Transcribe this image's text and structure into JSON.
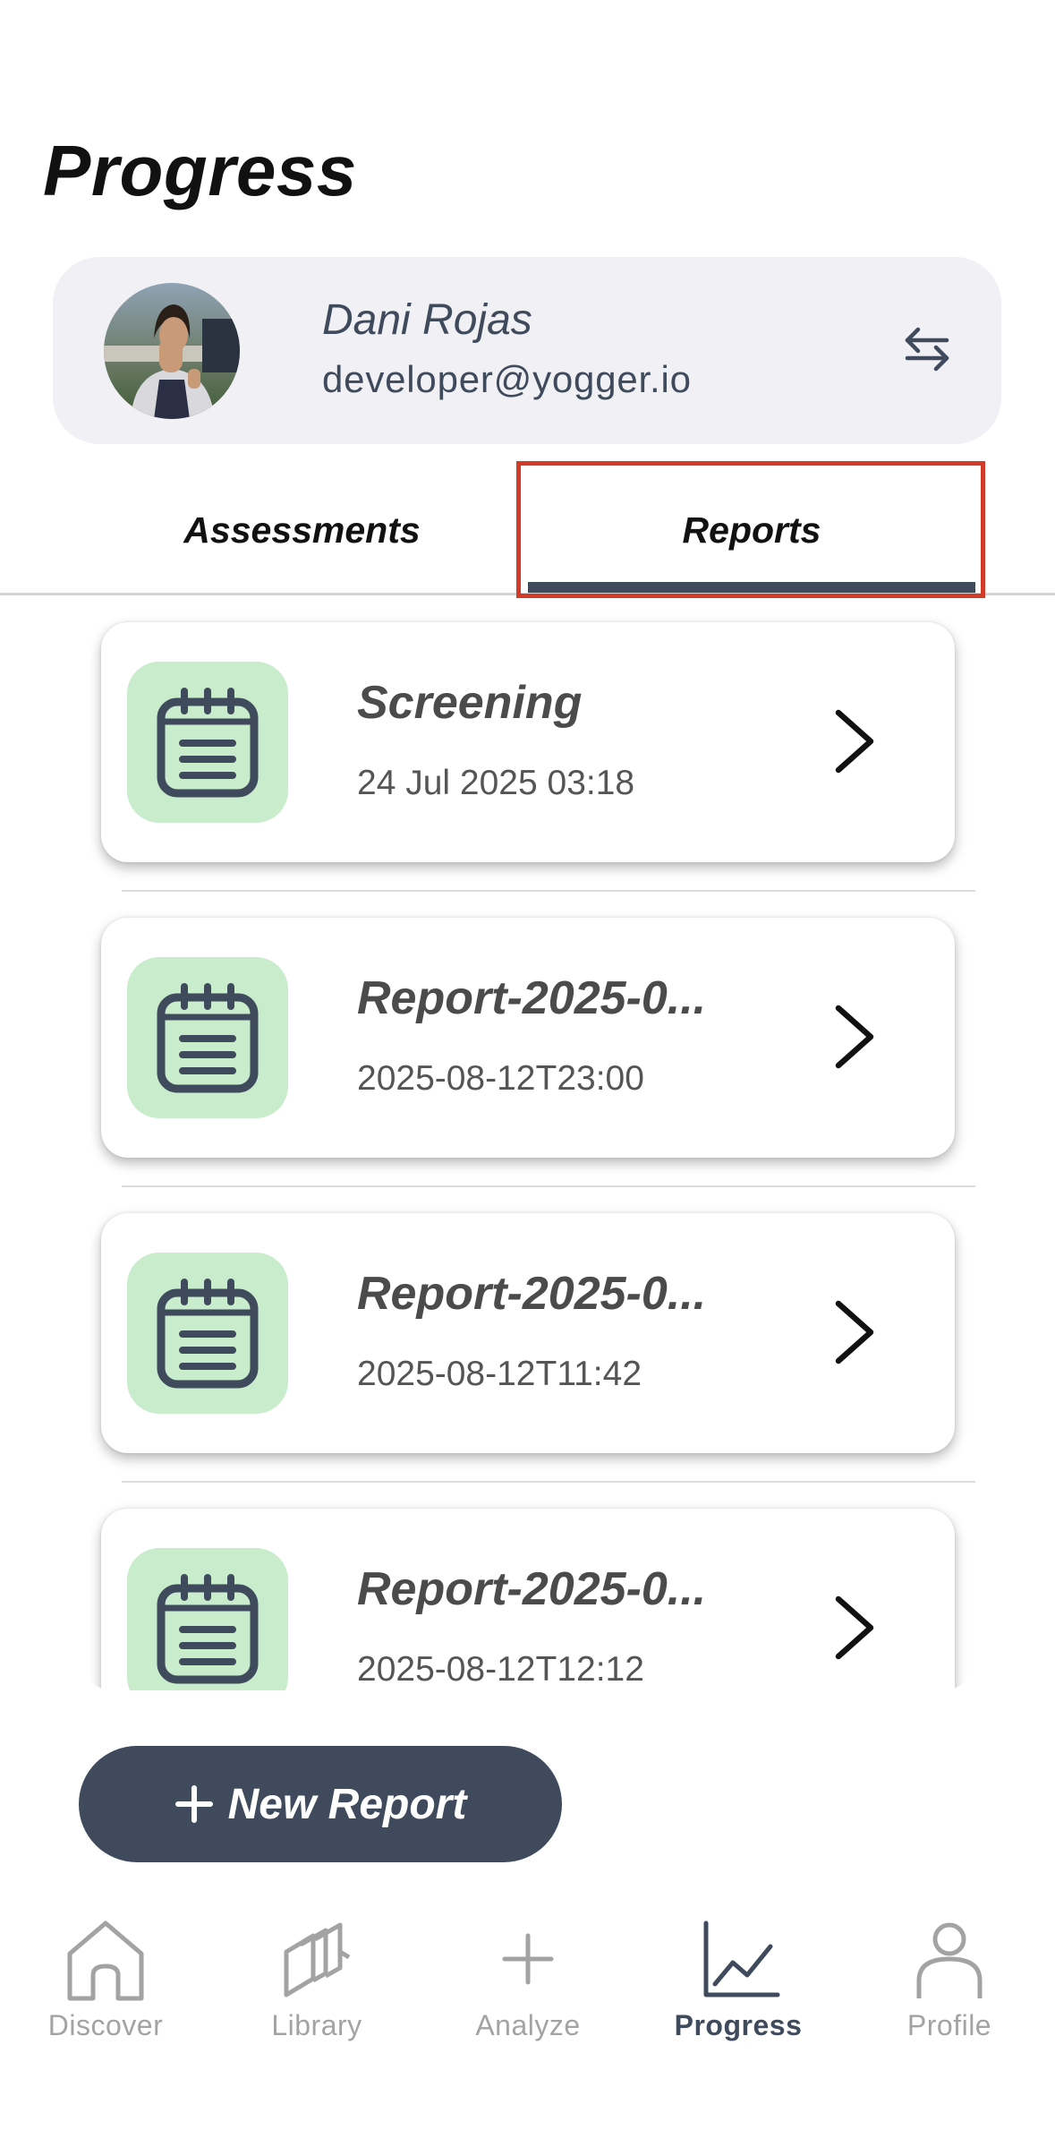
{
  "header": {
    "title": "Progress"
  },
  "profile": {
    "name": "Dani Rojas",
    "email": "developer@yogger.io",
    "avatar_icon": "user-photo",
    "switch_icon": "swap-arrows-icon"
  },
  "tabs": [
    {
      "label": "Assessments",
      "selected": false
    },
    {
      "label": "Reports",
      "selected": true
    }
  ],
  "reports": [
    {
      "title": "Screening",
      "date": "24 Jul 2025 03:18",
      "icon": "calendar-icon"
    },
    {
      "title": "Report-2025-0...",
      "date": "2025-08-12T23:00",
      "icon": "calendar-icon"
    },
    {
      "title": "Report-2025-0...",
      "date": "2025-08-12T11:42",
      "icon": "calendar-icon"
    },
    {
      "title": "Report-2025-0...",
      "date": "2025-08-12T12:12",
      "icon": "calendar-icon"
    }
  ],
  "new_report_button": {
    "label": "New Report",
    "icon": "plus-icon"
  },
  "bottom_nav": [
    {
      "label": "Discover",
      "icon": "home-icon",
      "active": false
    },
    {
      "label": "Library",
      "icon": "library-icon",
      "active": false
    },
    {
      "label": "Analyze",
      "icon": "plus-icon",
      "active": false
    },
    {
      "label": "Progress",
      "icon": "chart-icon",
      "active": true
    },
    {
      "label": "Profile",
      "icon": "person-icon",
      "active": false
    }
  ],
  "colors": {
    "accent": "#3f4a5c",
    "card_background": "#f0f0f5",
    "report_icon_background": "#c8eccc",
    "highlight": "#d23b27",
    "inactive_nav": "#a3a3a3"
  }
}
